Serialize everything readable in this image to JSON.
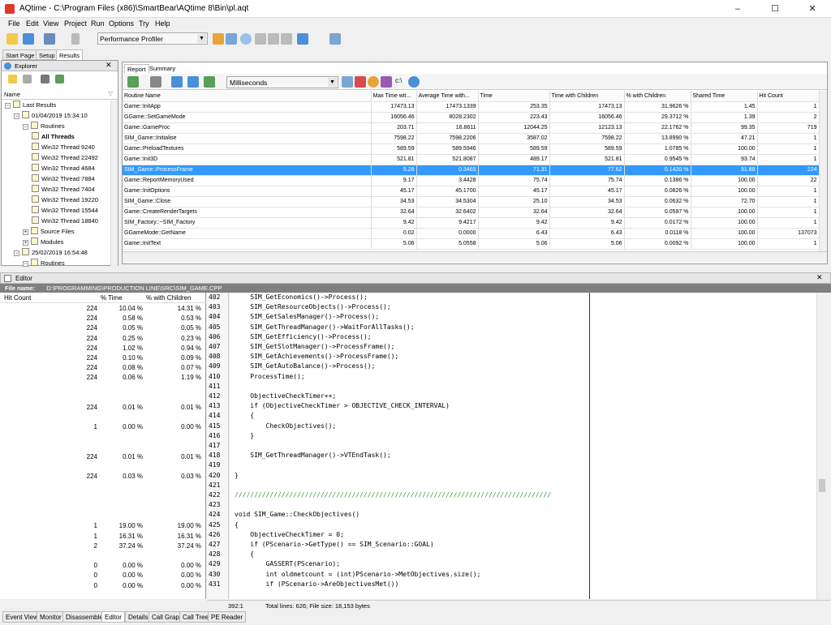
{
  "window": {
    "title": "AQtime - C:\\Program Files (x86)\\SmartBear\\AQtime 8\\Bin\\pl.aqt",
    "minimize": "–",
    "maximize": "☐",
    "close": "✕"
  },
  "menu": [
    "File",
    "Edit",
    "View",
    "Project",
    "Run",
    "Options",
    "Try",
    "Help"
  ],
  "toolbar": {
    "profiler": "Performance Profiler"
  },
  "doc_tabs": [
    "Start Page",
    "Setup",
    "Results"
  ],
  "explorer": {
    "title": "Explorer",
    "column": "Name",
    "tree": [
      {
        "label": "Last Results",
        "level": 0,
        "pm": "−"
      },
      {
        "label": "01/04/2019 15:34:10",
        "level": 1,
        "pm": "−"
      },
      {
        "label": "Routines",
        "level": 2,
        "pm": "−"
      },
      {
        "label": "All Threads",
        "level": 3,
        "selected": true
      },
      {
        "label": "Win32 Thread 9240",
        "level": 3
      },
      {
        "label": "Win32 Thread 22492",
        "level": 3
      },
      {
        "label": "Win32 Thread 4684",
        "level": 3
      },
      {
        "label": "Win32 Thread 7884",
        "level": 3
      },
      {
        "label": "Win32 Thread 7404",
        "level": 3
      },
      {
        "label": "Win32 Thread 19220",
        "level": 3
      },
      {
        "label": "Win32 Thread 15544",
        "level": 3
      },
      {
        "label": "Win32 Thread 18840",
        "level": 3
      },
      {
        "label": "Source Files",
        "level": 2,
        "pm": "+"
      },
      {
        "label": "Modules",
        "level": 2,
        "pm": "+"
      },
      {
        "label": "25/02/2019 16:54:48",
        "level": 1,
        "pm": "−"
      },
      {
        "label": "Routines",
        "level": 2,
        "pm": "−"
      }
    ]
  },
  "report": {
    "tabs": [
      "Report",
      "Summary"
    ],
    "units": "Milliseconds",
    "path_label": "c:\\",
    "columns": [
      "Routine Name",
      "Max Time wit...",
      "Average Time with...",
      "Time",
      "Time with Children",
      "% with Children",
      "Shared Time",
      "Hit Count"
    ],
    "rows": [
      [
        "Game::InitApp",
        "17473.13",
        "17473.1339",
        "253.35",
        "17473.13",
        "31.9626 %",
        "1.45",
        "1"
      ],
      [
        "GGame::SetGameMode",
        "16056.46",
        "8028.2302",
        "223.43",
        "16056.46",
        "29.3712 %",
        "1.39",
        "2"
      ],
      [
        "Game::GameProc",
        "203.71",
        "16.8611",
        "12044.25",
        "12123.13",
        "22.1762 %",
        "99.35",
        "719"
      ],
      [
        "SIM_Game::Initialise",
        "7598.22",
        "7598.2206",
        "3587.02",
        "7598.22",
        "13.8990 %",
        "47.21",
        "1"
      ],
      [
        "Game::PreloadTextures",
        "589.59",
        "589.5946",
        "589.59",
        "589.59",
        "1.0785 %",
        "100.00",
        "1"
      ],
      [
        "Game::Init3D",
        "521.81",
        "521.8087",
        "489.17",
        "521.81",
        "0.9545 %",
        "93.74",
        "1"
      ],
      [
        "SIM_Game::ProcessFrame",
        "5.28",
        "0.3465",
        "71.31",
        "77.62",
        "0.1420 %",
        "91.88",
        "224"
      ],
      [
        "Game::ReportMemoryUsed",
        "9.17",
        "3.4428",
        "75.74",
        "75.74",
        "0.1386 %",
        "100.00",
        "22"
      ],
      [
        "Game::InitOptions",
        "45.17",
        "45.1700",
        "45.17",
        "45.17",
        "0.0826 %",
        "100.00",
        "1"
      ],
      [
        "SIM_Game::Close",
        "34.53",
        "34.5304",
        "25.10",
        "34.53",
        "0.0632 %",
        "72.70",
        "1"
      ],
      [
        "Game::CreateRenderTargets",
        "32.64",
        "32.6402",
        "32.64",
        "32.64",
        "0.0597 %",
        "100.00",
        "1"
      ],
      [
        "SIM_Factory::~SIM_Factory",
        "9.42",
        "9.4217",
        "9.42",
        "9.42",
        "0.0172 %",
        "100.00",
        "1"
      ],
      [
        "GGameMode::GetName",
        "0.02",
        "0.0000",
        "6.43",
        "6.43",
        "0.0118 %",
        "100.00",
        "137073"
      ],
      [
        "Game::InitText",
        "5.06",
        "5.0558",
        "5.06",
        "5.06",
        "0.0092 %",
        "100.00",
        "1"
      ]
    ],
    "selected_row": 6
  },
  "editor": {
    "title": "Editor",
    "file_label": "File name:",
    "file_path": "D:\\PROGRAMMING\\PRODUCTION LINE\\SRC\\SIM_GAME.CPP",
    "stat_headers": [
      "Hit Count",
      "% Time",
      "% with Children"
    ],
    "stats": [
      [
        "224",
        "10.04 %",
        "14.31 %"
      ],
      [
        "224",
        "0.58 %",
        "0.53 %"
      ],
      [
        "224",
        "0.05 %",
        "0.05 %"
      ],
      [
        "224",
        "0.25 %",
        "0.23 %"
      ],
      [
        "224",
        "1.02 %",
        "0.94 %"
      ],
      [
        "224",
        "0.10 %",
        "0.09 %"
      ],
      [
        "224",
        "0.08 %",
        "0.07 %"
      ],
      [
        "224",
        "0.06 %",
        "1.19 %"
      ],
      [
        "",
        "",
        ""
      ],
      [
        "",
        "",
        ""
      ],
      [
        "224",
        "0.01 %",
        "0.01 %"
      ],
      [
        "",
        "",
        ""
      ],
      [
        "1",
        "0.00 %",
        "0.00 %"
      ],
      [
        "",
        "",
        ""
      ],
      [
        "",
        "",
        ""
      ],
      [
        "224",
        "0.01 %",
        "0.01 %"
      ],
      [
        "",
        "",
        ""
      ],
      [
        "224",
        "0.03 %",
        "0.03 %"
      ],
      [
        "",
        "",
        ""
      ],
      [
        "",
        "",
        ""
      ],
      [
        "",
        "",
        ""
      ],
      [
        "",
        "",
        ""
      ],
      [
        "1",
        "19.00 %",
        "19.00 %"
      ],
      [
        "1",
        "16.31 %",
        "16.31 %"
      ],
      [
        "2",
        "37.24 %",
        "37.24 %"
      ],
      [
        "",
        "",
        ""
      ],
      [
        "0",
        "0.00 %",
        "0.00 %"
      ],
      [
        "0",
        "0.00 %",
        "0.00 %"
      ],
      [
        "0",
        "0.00 %",
        "0.00 %"
      ]
    ],
    "line_numbers": [
      "402",
      "403",
      "404",
      "405",
      "406",
      "407",
      "408",
      "409",
      "410",
      "411",
      "412",
      "413",
      "414",
      "415",
      "416",
      "417",
      "418",
      "419",
      "420",
      "421",
      "422",
      "423",
      "424",
      "425",
      "426",
      "427",
      "428",
      "429",
      "430",
      "431"
    ],
    "code": [
      "    SIM_GetEconomics()->Process();",
      "    SIM_GetResourceObjects()->Process();",
      "    SIM_GetSalesManager()->Process();",
      "    SIM_GetThreadManager()->WaitForAllTasks();",
      "    SIM_GetEfficiency()->Process();",
      "    SIM_GetSlotManager()->ProcessFrame();",
      "    SIM_GetAchievements()->ProcessFrame();",
      "    SIM_GetAutoBalance()->Process();",
      "    ProcessTime();",
      "",
      "    ObjectiveCheckTimer++;",
      "    if (ObjectiveCheckTimer > OBJECTIVE_CHECK_INTERVAL)",
      "    {",
      "        CheckObjectives();",
      "    }",
      "",
      "    SIM_GetThreadManager()->VTEndTask();",
      "",
      "}",
      "",
      "/////////////////////////////////////////////////////////////////////////////////",
      "",
      "void SIM_Game::CheckObjectives()",
      "{",
      "    ObjectiveCheckTimer = 0;",
      "    if (PScenario->GetType() == SIM_Scenario::GOAL)",
      "    {",
      "        GASSERT(PScenario);",
      "        int oldmetcount = (int)PScenario->MetObjectives.size();",
      "        if (PScenario->AreObjectivesMet())"
    ],
    "status": {
      "position": "392:1",
      "info": "Total lines: 626; File size: 18,153 bytes"
    }
  },
  "bottom_tabs": [
    "Event View",
    "Monitor",
    "Disassembler",
    "Editor",
    "Details",
    "Call Graph",
    "Call Tree",
    "PE Reader"
  ],
  "active_bottom_tab": "Editor"
}
